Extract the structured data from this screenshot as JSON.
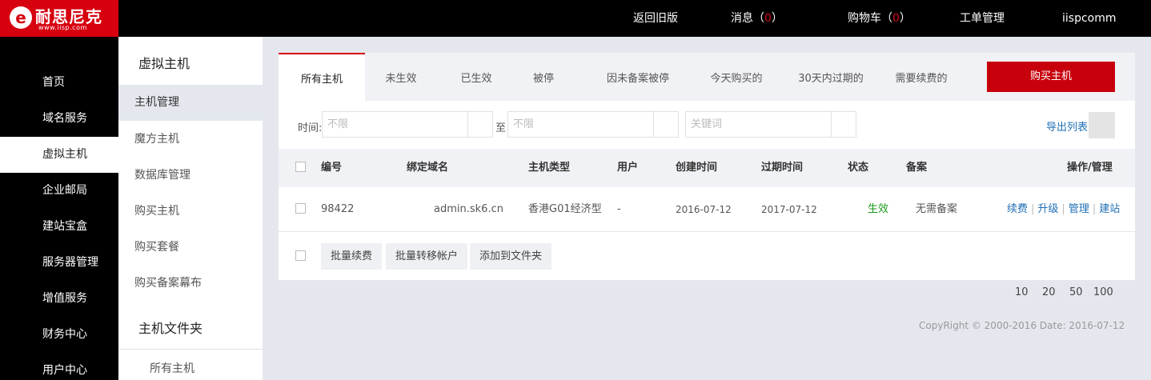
{
  "brand": {
    "logo_mark": "e",
    "name": "耐思尼克",
    "url": "www.iisp.com"
  },
  "topnav": {
    "old_version": "返回旧版",
    "messages_label": "消息（",
    "messages_count": "0",
    "messages_close": "）",
    "cart_label": "购物车（",
    "cart_count": "0",
    "cart_close": "）",
    "ticket": "工单管理",
    "username": "iispcomm"
  },
  "sidebar": {
    "items": [
      "首页",
      "域名服务",
      "虚拟主机",
      "企业邮局",
      "建站宝盒",
      "服务器管理",
      "增值服务",
      "财务中心",
      "用户中心"
    ],
    "active": "虚拟主机"
  },
  "subbar": {
    "title": "虚拟主机",
    "items": [
      "主机管理",
      "魔方主机",
      "数据库管理",
      "购买主机",
      "购买套餐",
      "购买备案幕布"
    ],
    "folder_title": "主机文件夹",
    "folder_items": [
      "所有主机"
    ]
  },
  "tabs": [
    "所有主机",
    "未生效",
    "已生效",
    "被停",
    "因未备案被停",
    "今天购买的",
    "30天内过期的",
    "需要续费的"
  ],
  "buy_button": "购买主机",
  "filter": {
    "time_label": "时间:",
    "from_placeholder": "不限",
    "to_label": "至",
    "to_placeholder": "不限",
    "keyword_placeholder": "关键词",
    "export": "导出列表"
  },
  "table": {
    "columns": [
      "编号",
      "绑定域名",
      "主机类型",
      "用户",
      "创建时间",
      "过期时间",
      "状态",
      "备案",
      "操作/管理"
    ],
    "rows": [
      {
        "id": "98422",
        "domain": "admin.sk6.cn",
        "type": "香港G01经济型",
        "user": "-",
        "created": "2016-07-12",
        "expires": "2017-07-12",
        "status": "生效",
        "record": "无需备案",
        "actions": [
          "续费",
          "升级",
          "管理",
          "建站"
        ]
      }
    ]
  },
  "batch": [
    "批量续费",
    "批量转移帐户",
    "添加到文件夹"
  ],
  "pager": [
    "10",
    "20",
    "50",
    "100"
  ],
  "footer": "CopyRight © 2000-2016 Date: 2016-07-12",
  "colors": {
    "brand_red": "#d6000f",
    "link_blue": "#1f6fb5",
    "status_green": "#1a9a1a"
  }
}
